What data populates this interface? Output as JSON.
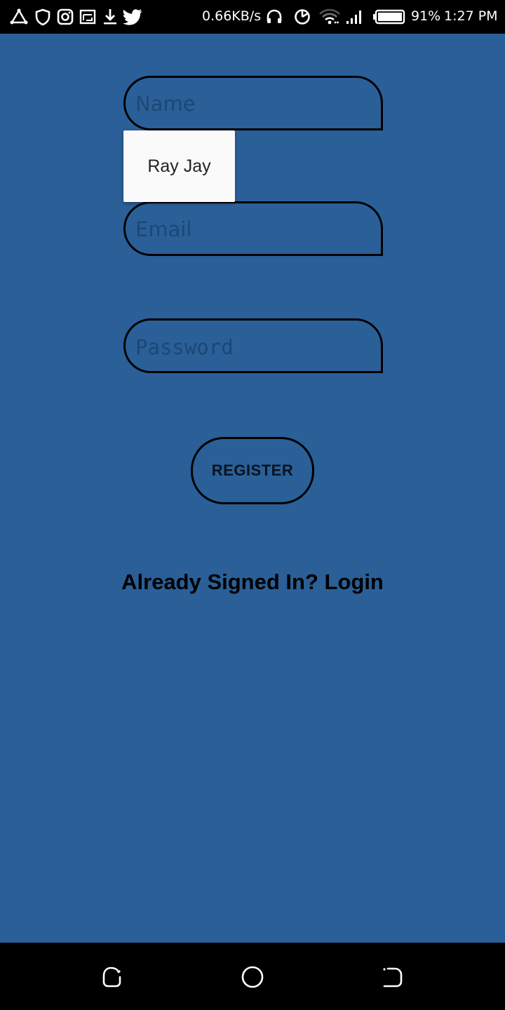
{
  "status_bar": {
    "speed": "0.66KB/s",
    "battery": "91%",
    "time": "1:27 PM",
    "left_icons": [
      "triangle-share-icon",
      "shield-icon",
      "instagram-icon",
      "cast-icon",
      "download-icon",
      "twitter-icon"
    ],
    "right_icons": [
      "headphones-icon",
      "data-saver-icon",
      "wifi-icon",
      "signal-icon",
      "battery-icon"
    ]
  },
  "form": {
    "name_placeholder": "Name",
    "email_placeholder": "Email",
    "password_placeholder": "Password",
    "register_label": "REGISTER",
    "login_text": "Already Signed In? Login"
  },
  "autofill": {
    "suggestion": "Ray Jay"
  },
  "nav_bar": {
    "icons": [
      "recents-icon",
      "home-icon",
      "back-icon"
    ]
  },
  "colors": {
    "background": "#2a5f98",
    "placeholder": "#1d4874",
    "bars": "#000000"
  }
}
